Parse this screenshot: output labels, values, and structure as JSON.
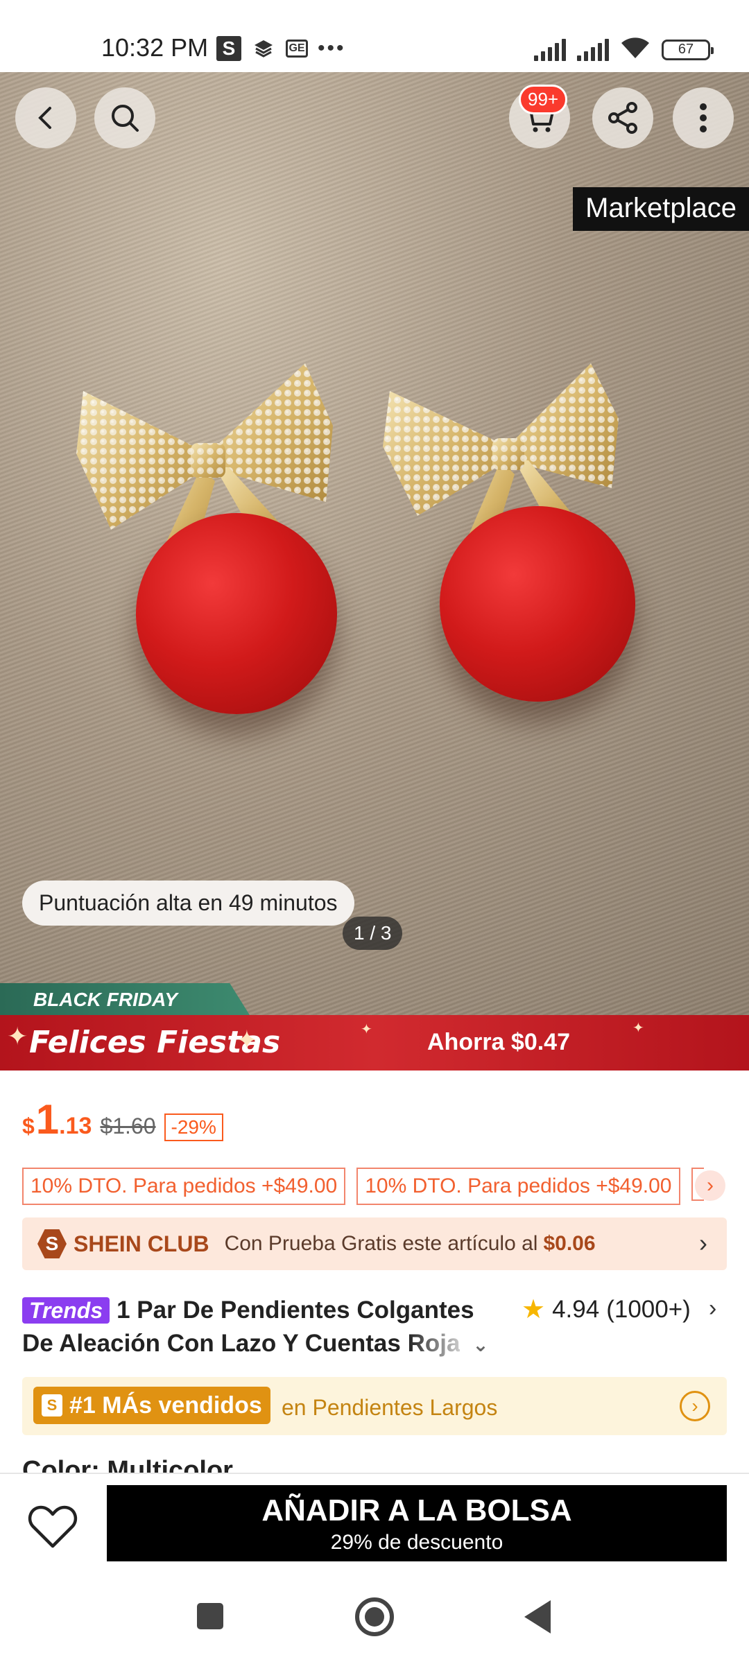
{
  "status_bar": {
    "time": "10:32 PM",
    "s_icon": "S",
    "ge_icon": "GE",
    "more": "•••",
    "battery": "67"
  },
  "hero": {
    "marketplace_label": "Marketplace",
    "cart_badge": "99+",
    "rating_hint": "Puntuación alta en 49 minutos",
    "page_indicator": "1 / 3",
    "black_friday": "BLACK FRIDAY",
    "promo_title": "Felices Fiestas",
    "promo_saving": "Ahorra $0.47"
  },
  "price": {
    "currency": "$",
    "integer": "1",
    "decimal": ".13",
    "original": "$1.60",
    "discount": "-29%"
  },
  "coupons": [
    "10% DTO. Para pedidos +$49.00",
    "10% DTO. Para pedidos +$49.00"
  ],
  "club": {
    "logo": "S",
    "name": "SHEIN CLUB",
    "text": "Con Prueba Gratis este artículo al",
    "amount": "$0.06"
  },
  "product": {
    "badge": "Trends",
    "title_line1": "1 Par De Pendientes Colgantes",
    "title_line2": "De Aleación Con Lazo Y Cuentas",
    "title_fade": "Roja",
    "rating": "4.94",
    "rating_count": "(1000+)"
  },
  "best_seller": {
    "tag": "#1 MÁs vendidos",
    "category": "en Pendientes Largos"
  },
  "color_row": "Color: Multicolor",
  "bottom_bar": {
    "add_label": "AÑADIR A LA BOLSA",
    "add_sub": "29% de descuento"
  },
  "colors": {
    "accent_orange": "#fa5a1d",
    "promo_red": "#c41a22",
    "trends_purple": "#8b3df0",
    "best_gold": "#e09212"
  }
}
